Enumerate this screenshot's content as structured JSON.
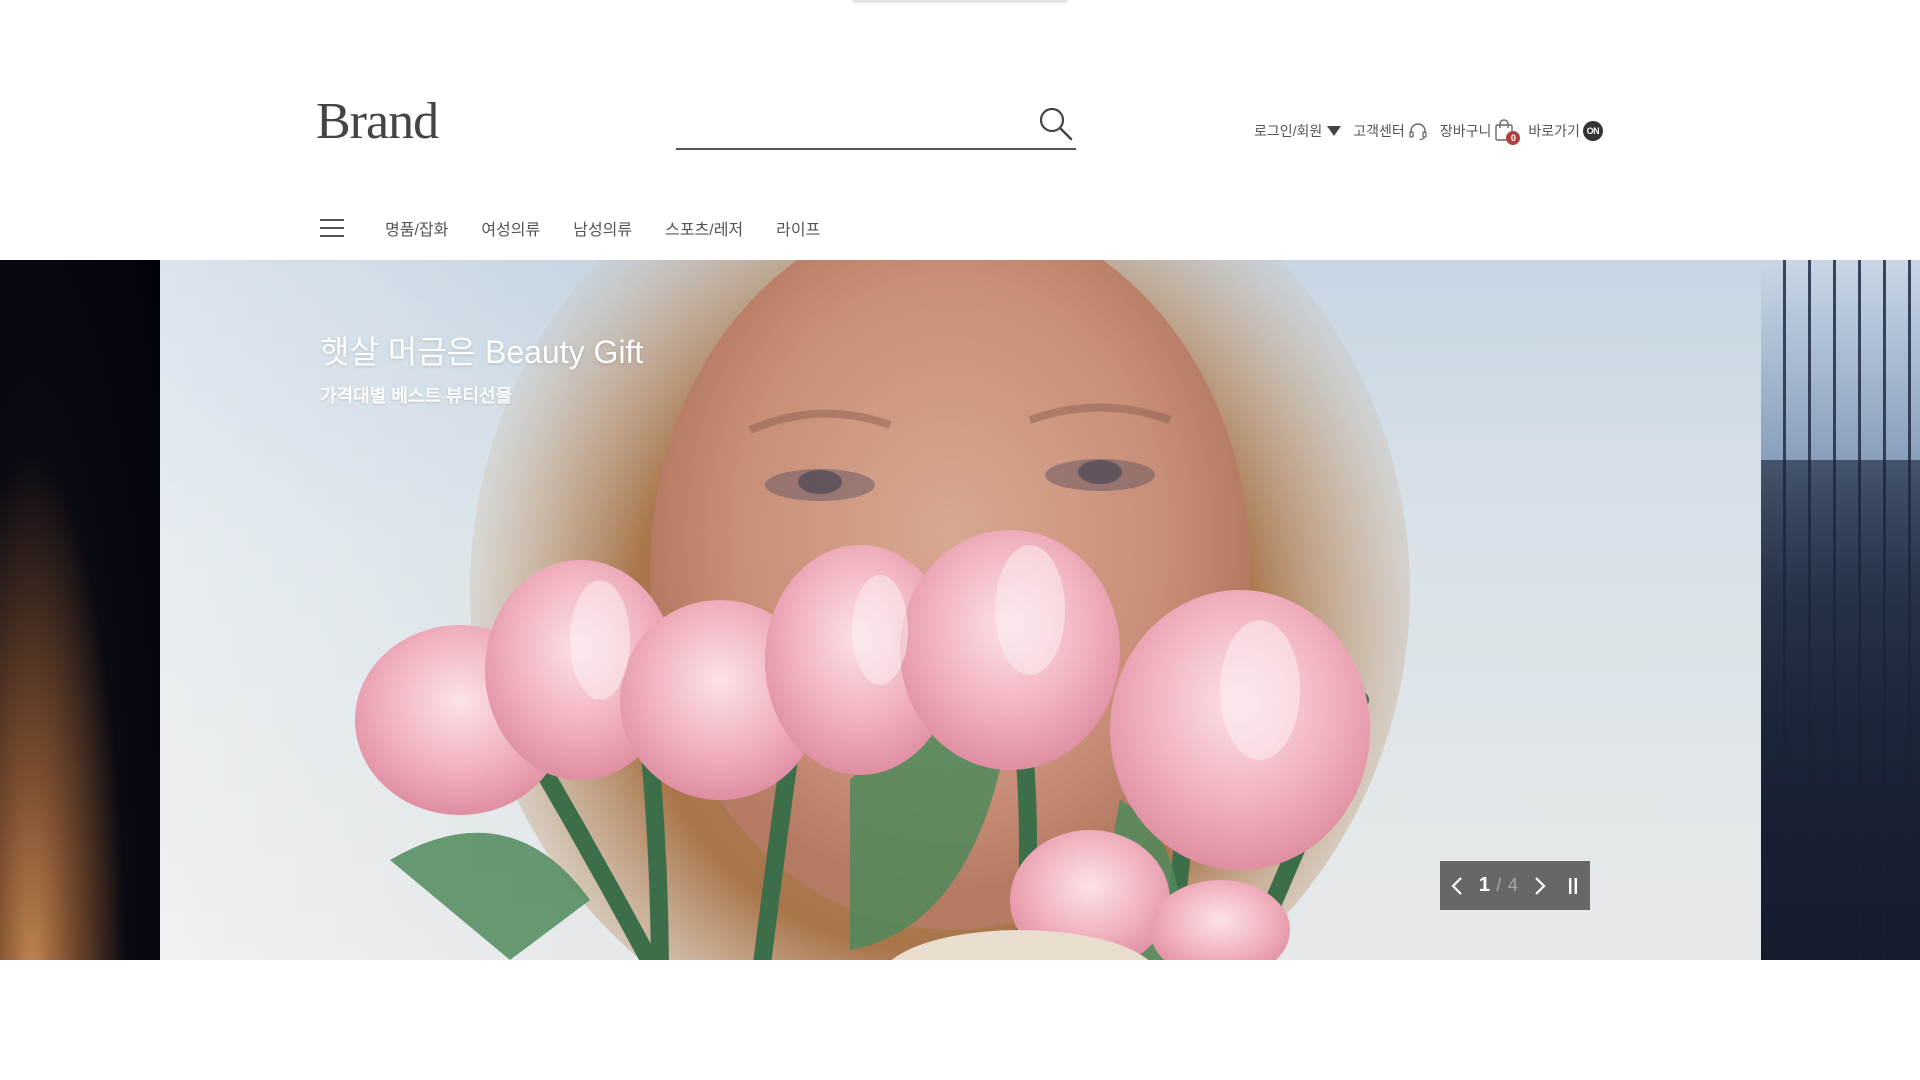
{
  "header": {
    "logo": "Brand",
    "search": {
      "value": "",
      "placeholder": ""
    },
    "util": {
      "login": "로그인/회원",
      "customer_center": "고객센터",
      "cart": "장바구니",
      "cart_count": "0",
      "shortcut": "바로가기",
      "shortcut_badge": "ON"
    }
  },
  "gnb": {
    "items": [
      "명품/잡화",
      "여성의류",
      "남성의류",
      "스포츠/레저",
      "라이프"
    ]
  },
  "hero": {
    "title": "햇살 머금은 Beauty Gift",
    "subtitle": "가격대별 베스트 뷰티선물",
    "pager": {
      "current": "1",
      "separator": "/",
      "total": "4"
    }
  },
  "icons": {
    "search": "search-icon",
    "headset": "headset-icon",
    "cart": "shopping-bag-icon",
    "menu": "hamburger-menu-icon",
    "prev": "chevron-left-icon",
    "next": "chevron-right-icon",
    "pause": "pause-icon",
    "caret": "caret-down-icon"
  }
}
